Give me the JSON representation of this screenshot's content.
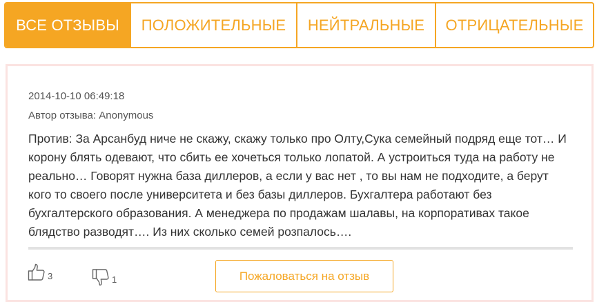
{
  "tabs": [
    {
      "label": "ВСЕ ОТЗЫВЫ",
      "active": true
    },
    {
      "label": "ПОЛОЖИТЕЛЬНЫЕ",
      "active": false
    },
    {
      "label": "НЕЙТРАЛЬНЫЕ",
      "active": false
    },
    {
      "label": "ОТРИЦАТЕЛЬНЫЕ",
      "active": false
    }
  ],
  "review": {
    "date": "2014-10-10 06:49:18",
    "author": "Автор отзыва: Anonymous",
    "text": "Против: За Арсанбуд ниче не скажу, скажу только про Олту,Сука семейный подряд еще тот… И корону блять одевают, что сбить ее хочеться только лопатой. А устроиться туда на работу не реально… Говорят нужна база диллеров, а если у вас нет , то вы нам не подходите, а берут кого то своего после университета и без базы диллеров. Бухгалтера работают без бухгалтерского образования. А менеджера по продажам шалавы, на корпоративах такое блядство разводят…. Из них сколько семей розпалось….",
    "likes": "3",
    "dislikes": "1",
    "complain_label": "Пожаловаться на отзыв"
  },
  "icons": {
    "like": "thumbs-up-icon",
    "dislike": "thumbs-down-icon"
  },
  "colors": {
    "accent": "#f5a623",
    "card_border": "#fbe3e1",
    "text": "#333333",
    "meta_text": "#555555",
    "divider": "#e2e2e2"
  }
}
